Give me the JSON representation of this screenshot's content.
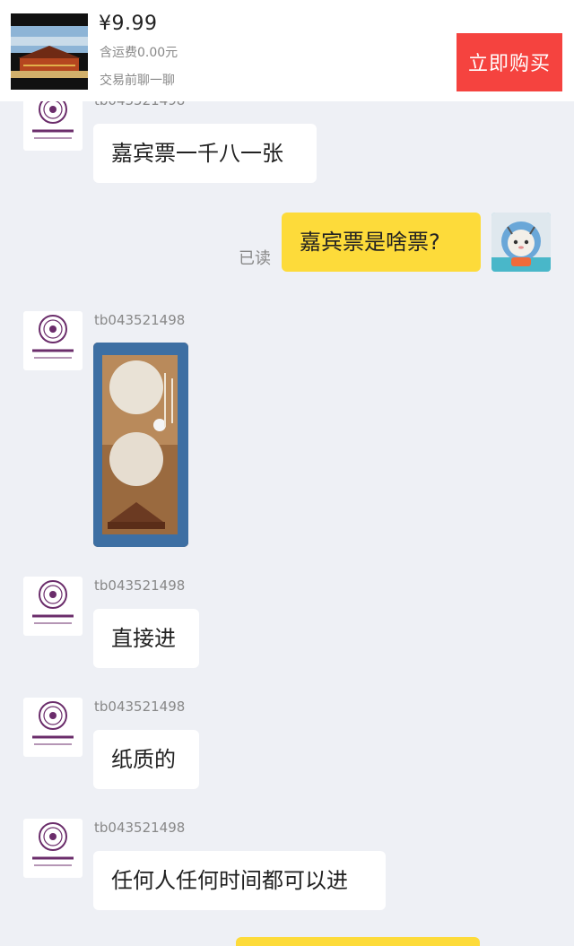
{
  "product": {
    "price": "¥9.99",
    "shipping": "含运费0.00元",
    "chat_hint": "交易前聊一聊",
    "buy_label": "立即购买",
    "image_icon": "forbidden-city-photo-icon"
  },
  "messages": [
    {
      "sender": "tb043521498",
      "text": "嘉宾票一千八一张",
      "username_visible": "partially-clipped"
    },
    {
      "sender": "me",
      "text": "嘉宾票是啥票?",
      "status": "已读"
    },
    {
      "sender": "tb043521498",
      "type": "image",
      "image_icon": "ticket-photo-icon"
    },
    {
      "sender": "tb043521498",
      "text": "直接进"
    },
    {
      "sender": "tb043521498",
      "text": "纸质的"
    },
    {
      "sender": "tb043521498",
      "text": "任何人任何时间都可以进"
    }
  ],
  "usernames": {
    "seller": "tb043521498",
    "seller_clipped": "tb043521498"
  },
  "colors": {
    "buy_button": "#f5433f",
    "my_bubble": "#fddb3a",
    "their_bubble": "#ffffff",
    "background": "#eef0f5",
    "seller_logo": "#6b2d6b"
  },
  "icons": {
    "seller_avatar": "tsinghua-university-logo-icon",
    "my_avatar": "astronaut-cat-icon"
  }
}
